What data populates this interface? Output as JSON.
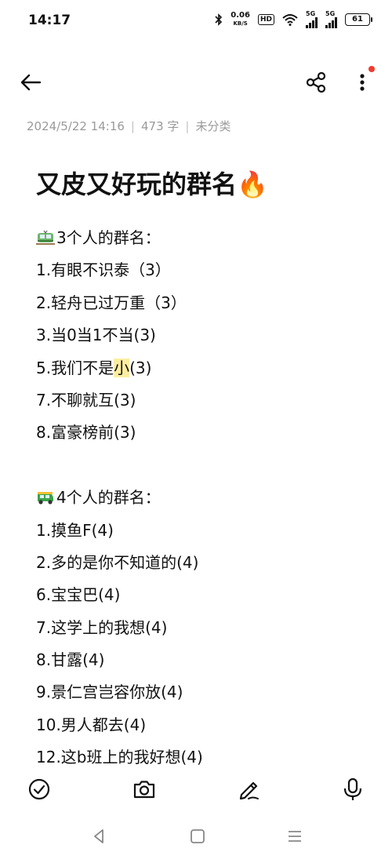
{
  "status_bar": {
    "time": "14:17",
    "net_speed": "0.06",
    "net_unit": "KB/S",
    "hd_label": "HD",
    "signal_1_label": "5G",
    "signal_2_label": "5G",
    "battery": "61"
  },
  "note": {
    "meta_date": "2024/5/22 14:16",
    "meta_count": "473 字",
    "meta_category": "未分类",
    "title": "又皮又好玩的群名🔥"
  },
  "sections": [
    {
      "heading": "3个人的群名：",
      "icon": "tram-icon",
      "items": [
        "1.有眼不识泰（3）",
        "2.轻舟已过万重（3）",
        "3.当0当1不当(3)",
        "7.不聊就互(3)",
        "8.富豪榜前(3)"
      ],
      "highlight_item": {
        "prefix": "5.我们不是",
        "highlight": "小",
        "suffix": "(3)"
      }
    },
    {
      "heading": "4个人的群名：",
      "icon": "auto-rickshaw-icon",
      "items": [
        "1.摸鱼F(4)",
        "2.多的是你不知道的(4)",
        "6.宝宝巴(4)",
        "7.这学上的我想(4)",
        "8.甘露(4)",
        "9.景仁宫岂容你放(4)",
        "10.男人都去(4)",
        "12.这b班上的我好想(4)"
      ]
    }
  ],
  "colors": {
    "accent_dot": "#f23b2f",
    "highlight": "#fbeea0",
    "meta_text": "#9a9a9a"
  }
}
